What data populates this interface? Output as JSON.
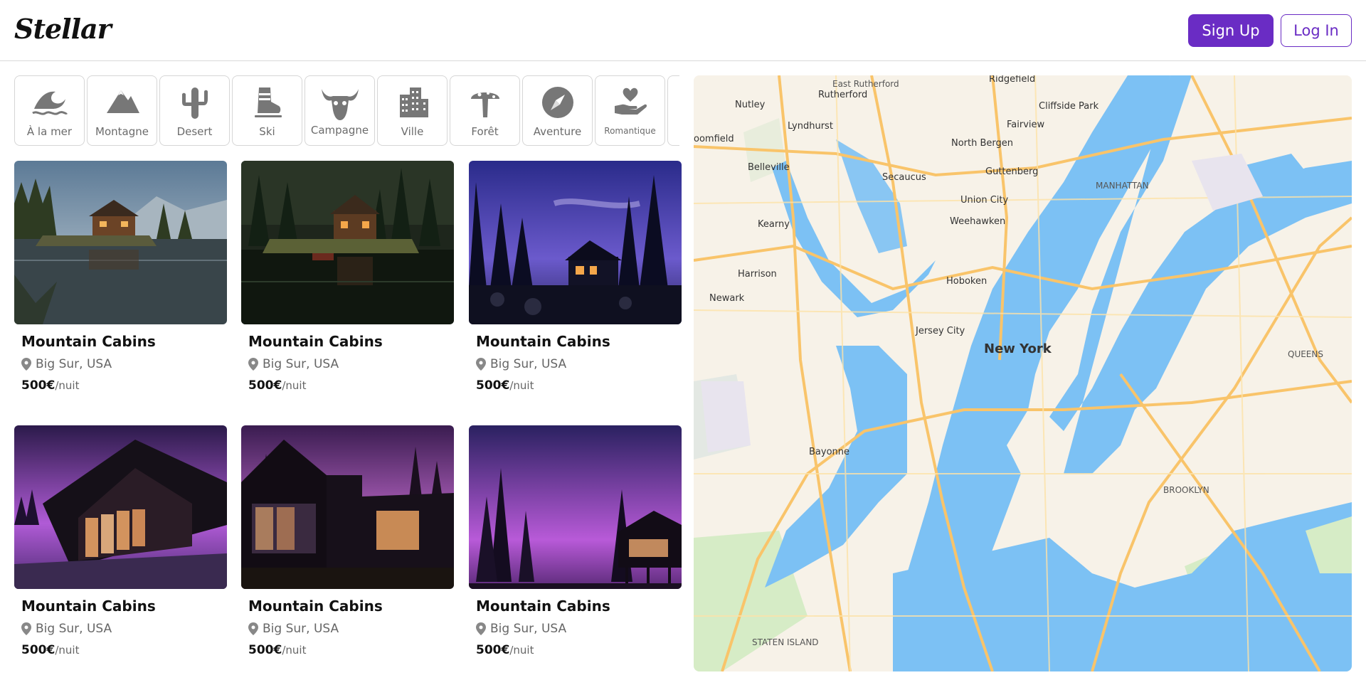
{
  "brand": {
    "logo": "Stellar",
    "accent": "#6a2cc4"
  },
  "header": {
    "signup_label": "Sign Up",
    "login_label": "Log In"
  },
  "categories": [
    {
      "label": "À la mer",
      "icon": "wave-icon"
    },
    {
      "label": "Montagne",
      "icon": "mountain-icon"
    },
    {
      "label": "Desert",
      "icon": "cactus-icon"
    },
    {
      "label": "Ski",
      "icon": "ski-boot-icon"
    },
    {
      "label": "Campagne",
      "icon": "bull-skull-icon"
    },
    {
      "label": "Ville",
      "icon": "city-icon"
    },
    {
      "label": "Forêt",
      "icon": "mushroom-icon"
    },
    {
      "label": "Aventure",
      "icon": "compass-icon"
    },
    {
      "label": "Romantique",
      "icon": "heart-hand-icon"
    }
  ],
  "listings": [
    {
      "title": "Mountain Cabins",
      "location": "Big Sur, USA",
      "price": "500€",
      "unit": "/nuit",
      "scene": "lake-day"
    },
    {
      "title": "Mountain Cabins",
      "location": "Big Sur, USA",
      "price": "500€",
      "unit": "/nuit",
      "scene": "forest-dusk"
    },
    {
      "title": "Mountain Cabins",
      "location": "Big Sur, USA",
      "price": "500€",
      "unit": "/nuit",
      "scene": "night-blue"
    },
    {
      "title": "Mountain Cabins",
      "location": "Big Sur, USA",
      "price": "500€",
      "unit": "/nuit",
      "scene": "purple-glass-house"
    },
    {
      "title": "Mountain Cabins",
      "location": "Big Sur, USA",
      "price": "500€",
      "unit": "/nuit",
      "scene": "purple-modern-house"
    },
    {
      "title": "Mountain Cabins",
      "location": "Big Sur, USA",
      "price": "500€",
      "unit": "/nuit",
      "scene": "purple-stilt-house"
    }
  ],
  "map": {
    "labels": {
      "new_york": "New York",
      "jersey_city": "Jersey City",
      "hoboken": "Hoboken",
      "newark": "Newark",
      "bayonne": "Bayonne",
      "harrison": "Harrison",
      "kearny": "Kearny",
      "belleville": "Belleville",
      "nutley": "Nutley",
      "lyndhurst": "Lyndhurst",
      "rutherford": "Rutherford",
      "secaucus": "Secaucus",
      "union_city": "Union City",
      "weehawken": "Weehawken",
      "north_bergen": "North Bergen",
      "guttenberg": "Guttenberg",
      "fairview": "Fairview",
      "cliffside_park": "Cliffside Park",
      "ridgefield": "Ridgefield",
      "east_rutherford": "East Rutherford",
      "bloomfield": "oomfield",
      "brooklyn": "BROOKLYN",
      "queens": "QUEENS",
      "manhattan": "MANHATTAN",
      "staten_island": "STATEN ISLAND"
    },
    "colors": {
      "water": "#7cc1f4",
      "land": "#f7f2e8",
      "road": "#f9c46a",
      "park": "#d6ecc6"
    }
  }
}
